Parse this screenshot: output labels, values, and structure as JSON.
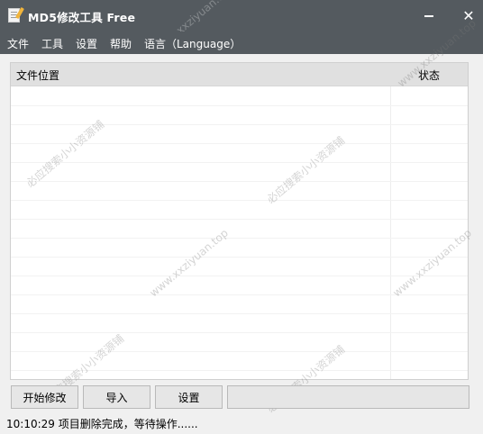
{
  "window": {
    "title": "MD5修改工具 Free",
    "minimize_glyph": "",
    "close_glyph": "✕",
    "icon": "notepad-pencil-icon"
  },
  "menu": {
    "items": [
      "文件",
      "工具",
      "设置",
      "帮助",
      "语言（Language）"
    ]
  },
  "list": {
    "columns": [
      "文件位置",
      "状态"
    ],
    "rows": []
  },
  "buttons": {
    "start": "开始修改",
    "import": "导入",
    "settings": "设置"
  },
  "progress": {
    "value": 0,
    "fill_color": "#06b025"
  },
  "status": {
    "text": "10:10:29 项目删除完成，等待操作......"
  },
  "watermarks": {
    "site": "www.xxziyuan.top",
    "cn": "必应搜索小小资源铺"
  },
  "colors": {
    "titlebar": "#545a5f",
    "header": "#e0e0e0"
  }
}
